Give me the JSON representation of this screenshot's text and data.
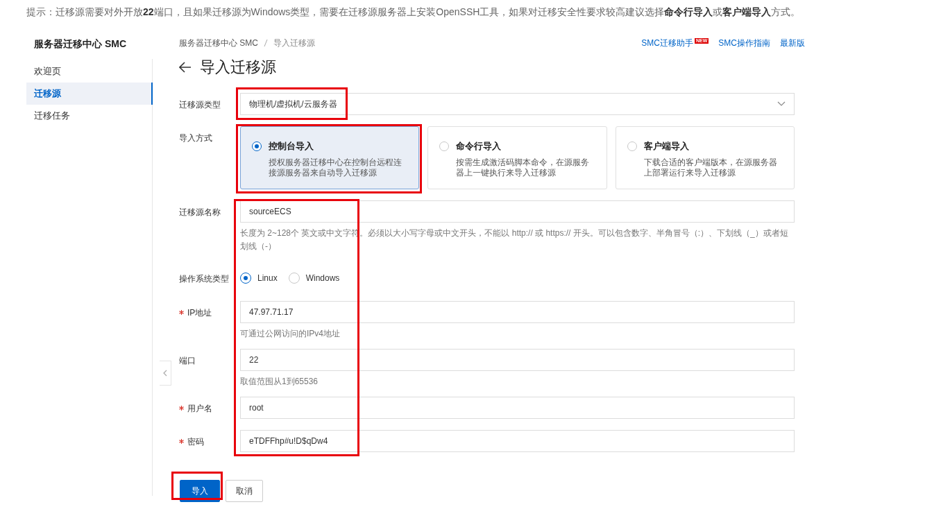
{
  "notice": "提示：迁移源需要对外开放**22**端口，且如果迁移源为Windows类型，需要在迁移源服务器上安装OpenSSH工具，如果对迁移安全性要求较高建议选择**命令行导入**或**客户端导入**方式。",
  "sidebar": {
    "title": "服务器迁移中心 SMC",
    "items": [
      {
        "label": "欢迎页",
        "selected": false
      },
      {
        "label": "迁移源",
        "selected": true
      },
      {
        "label": "迁移任务",
        "selected": false
      }
    ]
  },
  "breadcrumb": [
    "服务器迁移中心 SMC",
    "导入迁移源"
  ],
  "header_links": [
    {
      "label": "SMC迁移助手",
      "badge": "NEW"
    },
    {
      "label": "SMC操作指南"
    },
    {
      "label": "最新版"
    }
  ],
  "page_title": "导入迁移源",
  "form_rows": [
    {
      "kind": "select",
      "label": "迁移源类型",
      "required": false,
      "value": "物理机/虚拟机/云服务器"
    },
    {
      "kind": "cards",
      "label": "导入方式",
      "required": false,
      "options": [
        {
          "title": "控制台导入",
          "description": "授权服务器迁移中心在控制台远程连接源服务器来自动导入迁移源",
          "selected": true
        },
        {
          "title": "命令行导入",
          "description": "按需生成激活码脚本命令，在源服务器上一键执行来导入迁移源",
          "selected": false
        },
        {
          "title": "客户端导入",
          "description": "下载合适的客户端版本，在源服务器上部署运行来导入迁移源",
          "selected": false
        }
      ]
    },
    {
      "kind": "text",
      "label": "迁移源名称",
      "required": false,
      "value": "sourceECS",
      "help": "长度为 2~128个 英文或中文字符。必须以大小写字母或中文开头，不能以 http:// 或 https:// 开头。可以包含数字、半角冒号（:）、下划线（_）或者短划线（-）"
    },
    {
      "kind": "radio",
      "label": "操作系统类型",
      "required": false,
      "options": [
        {
          "label": "Linux",
          "selected": true
        },
        {
          "label": "Windows",
          "selected": false
        }
      ]
    },
    {
      "kind": "text",
      "label": "IP地址",
      "required": true,
      "value": "47.97.71.17",
      "help": "可通过公网访问的IPv4地址"
    },
    {
      "kind": "text",
      "label": "端口",
      "required": false,
      "value": "22",
      "help": "取值范围从1到65536"
    },
    {
      "kind": "text",
      "label": "用户名",
      "required": true,
      "value": "root"
    },
    {
      "kind": "text",
      "label": "密码",
      "required": true,
      "value": "eTDFFhp#u!D$qDw4"
    }
  ],
  "buttons": [
    {
      "label": "导入",
      "kind": "primary"
    },
    {
      "label": "取消",
      "kind": "default"
    }
  ],
  "annotation_frames": [
    {
      "kind": "type-select"
    },
    {
      "kind": "method-card"
    },
    {
      "kind": "credential-fields"
    },
    {
      "kind": "submit-button"
    }
  ]
}
